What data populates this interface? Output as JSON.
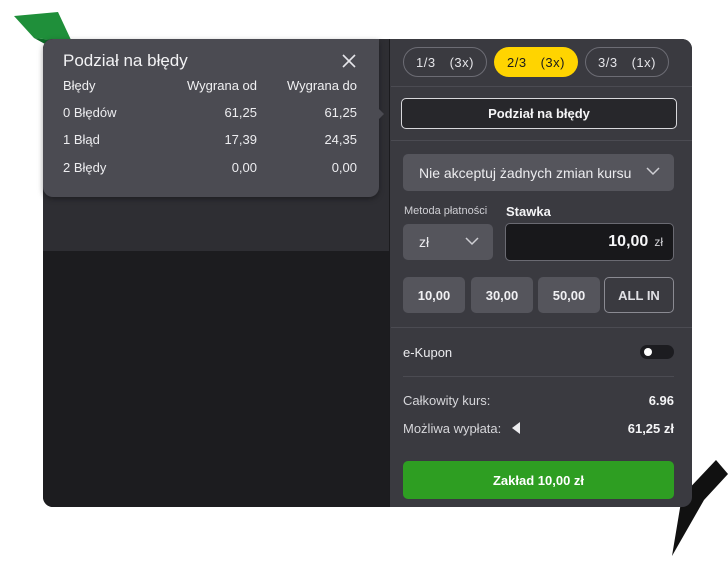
{
  "popup": {
    "title": "Podział na błędy",
    "headers": [
      "Błędy",
      "Wygrana od",
      "Wygrana do"
    ],
    "rows": [
      {
        "label": "0 Błędów",
        "from": "61,25",
        "to": "61,25"
      },
      {
        "label": "1 Błąd",
        "from": "17,39",
        "to": "24,35"
      },
      {
        "label": "2 Błędy",
        "from": "0,00",
        "to": "0,00"
      }
    ]
  },
  "tabs": [
    {
      "fraction": "1/3",
      "count": "(3x)",
      "active": false
    },
    {
      "fraction": "2/3",
      "count": "(3x)",
      "active": true
    },
    {
      "fraction": "3/3",
      "count": "(1x)",
      "active": false
    }
  ],
  "breakdown_button": "Podział na błędy",
  "odds_select": "Nie akceptuj żadnych zmian kursu",
  "payment": {
    "label": "Metoda płatności",
    "currency": "zł"
  },
  "stake": {
    "label": "Stawka",
    "value": "10,00",
    "currency": "zł"
  },
  "quick_amounts": [
    "10,00",
    "30,00",
    "50,00",
    "ALL IN"
  ],
  "ekupon": {
    "label": "e-Kupon",
    "enabled": false
  },
  "summary": {
    "total_odds_label": "Całkowity kurs:",
    "total_odds_value": "6.96",
    "payout_label": "Możliwa wypłata:",
    "payout_value": "61,25 zł"
  },
  "place_bet_button": "Zakład 10,00 zł",
  "colors": {
    "accent": "#ffd400",
    "primary_button": "#2e9e22",
    "panel": "#3a3a40",
    "popup": "#4b4b52"
  }
}
